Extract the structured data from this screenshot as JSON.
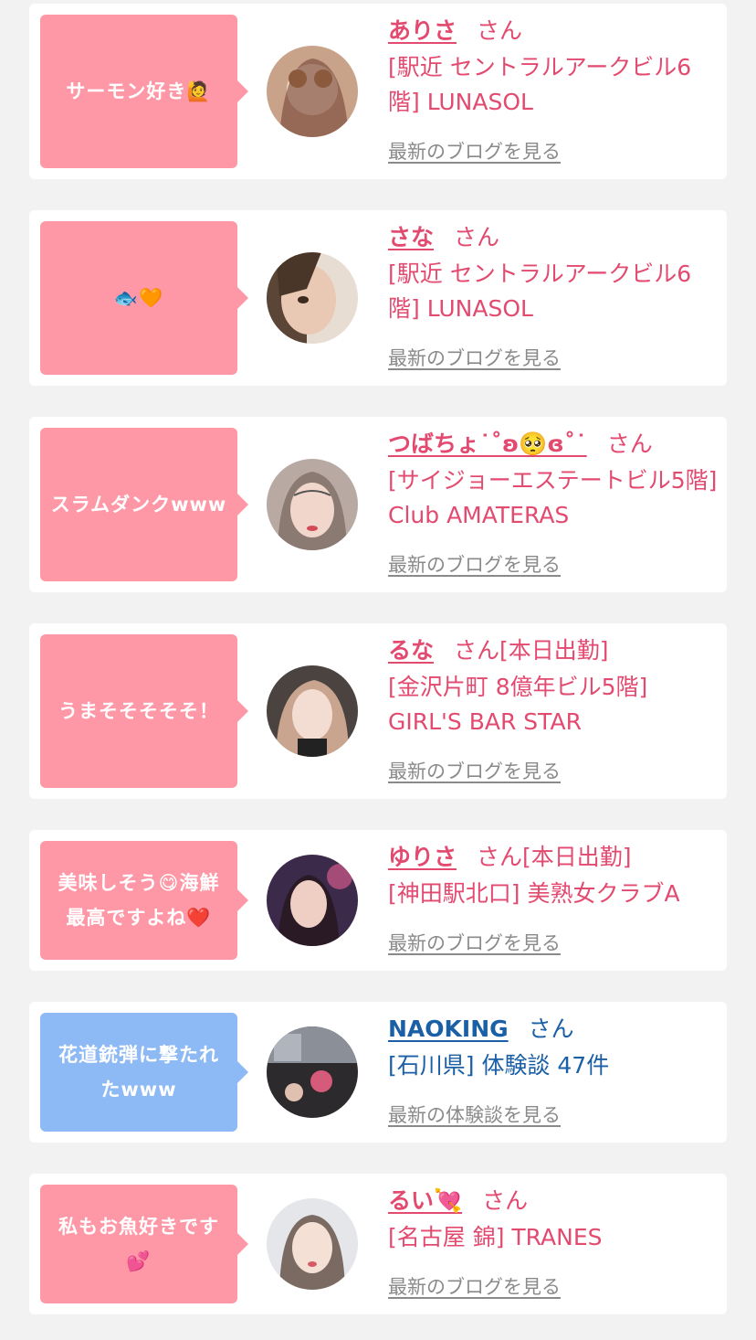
{
  "cards": [
    {
      "comment": "サーモン好き🙋",
      "name": "ありさ",
      "san": "さん",
      "location": "[駅近 セントラルアークビル6階] LUNASOL",
      "more": "最新のブログを見る",
      "theme": "pink"
    },
    {
      "comment": "🐟🧡",
      "name": "さな",
      "san": "さん",
      "location": "[駅近 セントラルアークビル6階] LUNASOL",
      "more": "最新のブログを見る",
      "theme": "pink"
    },
    {
      "comment": "スラムダンクwww",
      "name": "つばちょ˙˚ʚ🥺ɞ˚˙",
      "san": "さん",
      "location": "[サイジョーエステートビル5階] Club AMATERAS",
      "more": "最新のブログを見る",
      "theme": "pink"
    },
    {
      "comment": "うまそそそそそ！",
      "name": "るな",
      "san": "さん[本日出勤]",
      "location": "[金沢片町 8億年ビル5階] GIRL'S BAR STAR",
      "more": "最新のブログを見る",
      "theme": "pink"
    },
    {
      "comment": "美味しそう😋海鮮最高ですよね❤️",
      "name": "ゆりさ",
      "san": "さん[本日出勤]",
      "location": "[神田駅北口] 美熟女クラブA",
      "more": "最新のブログを見る",
      "theme": "pink"
    },
    {
      "comment": "花道銃弾に撃たれたwww",
      "name": "NAOKING",
      "san": "さん",
      "location": "[石川県] 体験談 47件",
      "more": "最新の体験談を見る",
      "theme": "blue"
    },
    {
      "comment": "私もお魚好きです💕",
      "name": "るい💘",
      "san": "さん",
      "location": "[名古屋 錦] TRANES",
      "more": "最新のブログを見る",
      "theme": "pink"
    }
  ]
}
